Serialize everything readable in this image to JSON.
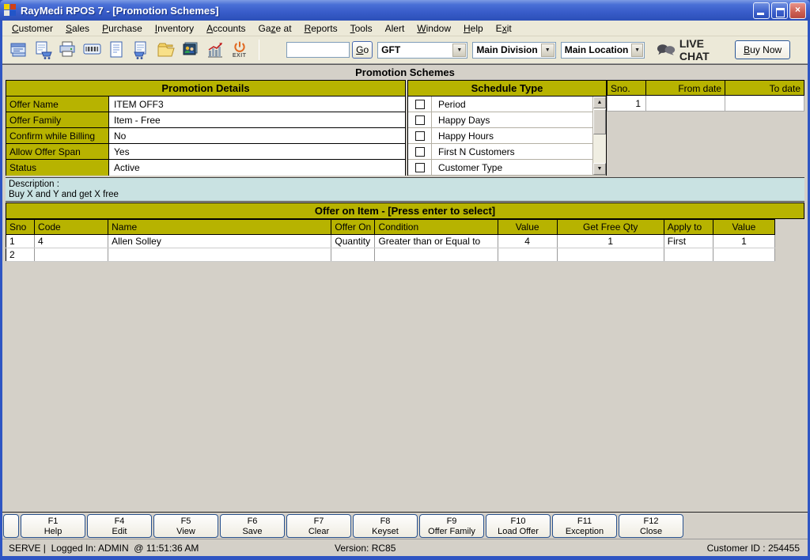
{
  "window": {
    "title": "RayMedi RPOS 7 - [Promotion Schemes]"
  },
  "menu": {
    "items": [
      {
        "label": "Customer",
        "accel": 0
      },
      {
        "label": "Sales",
        "accel": 0
      },
      {
        "label": "Purchase",
        "accel": 0
      },
      {
        "label": "Inventory",
        "accel": 0
      },
      {
        "label": "Accounts",
        "accel": 0
      },
      {
        "label": "Gaze at",
        "accel": 2
      },
      {
        "label": "Reports",
        "accel": 0
      },
      {
        "label": "Tools",
        "accel": 0
      },
      {
        "label": "Alert",
        "accel": -1
      },
      {
        "label": "Window",
        "accel": 0
      },
      {
        "label": "Help",
        "accel": 0
      },
      {
        "label": "Exit",
        "accel": 1
      }
    ]
  },
  "toolbar": {
    "icons": [
      "billing-icon",
      "sales-cart-icon",
      "printer-icon",
      "barcode-icon",
      "ledger-icon",
      "purchase-cart-icon",
      "folder-icon",
      "customers-icon",
      "chart-icon",
      "exit-power-icon"
    ],
    "exit_label": "EXIT",
    "search_value": "",
    "go_button": {
      "label": "Go",
      "accel": 0
    },
    "combos": [
      "GFT",
      "Main Division",
      "Main Location"
    ],
    "live_chat_label": "LIVE CHAT",
    "buy_now_button": {
      "label": "Buy Now",
      "accel": 0
    }
  },
  "page": {
    "title": "Promotion Schemes"
  },
  "promotion_details": {
    "header": "Promotion Details",
    "rows": [
      {
        "label": "Offer Name",
        "value": "ITEM OFF3"
      },
      {
        "label": "Offer Family",
        "value": "Item - Free"
      },
      {
        "label": "Confirm while Billing",
        "value": "No"
      },
      {
        "label": "Allow Offer Span",
        "value": "Yes"
      },
      {
        "label": "Status",
        "value": "Active"
      }
    ]
  },
  "schedule_type": {
    "header": "Schedule Type",
    "options": [
      {
        "label": "Period",
        "checked": false
      },
      {
        "label": "Happy Days",
        "checked": false
      },
      {
        "label": "Happy Hours",
        "checked": false
      },
      {
        "label": "First N Customers",
        "checked": false
      },
      {
        "label": "Customer Type",
        "checked": false
      }
    ]
  },
  "schedule_table": {
    "columns": [
      "Sno.",
      "From date",
      "To date"
    ],
    "rows": [
      {
        "sno": "1",
        "from_date": "",
        "to_date": ""
      }
    ]
  },
  "description": {
    "label": "Description :",
    "text": "Buy X and Y and get X free"
  },
  "offer_on_item": {
    "header": "Offer on Item - [Press enter to select]",
    "columns": [
      "Sno",
      "Code",
      "Name",
      "Offer On",
      "Condition",
      "Value",
      "Get Free Qty",
      "Apply to",
      "Value"
    ],
    "rows": [
      [
        "1",
        "4",
        "Allen Solley",
        "Quantity",
        "Greater than or Equal to",
        "4",
        "1",
        "First",
        "1"
      ],
      [
        "2",
        "",
        "",
        "",
        "",
        "",
        "",
        "",
        ""
      ]
    ]
  },
  "function_keys": [
    {
      "key": "F1",
      "label": "Help"
    },
    {
      "key": "F4",
      "label": "Edit"
    },
    {
      "key": "F5",
      "label": "View"
    },
    {
      "key": "F6",
      "label": "Save"
    },
    {
      "key": "F7",
      "label": "Clear"
    },
    {
      "key": "F8",
      "label": "Keyset"
    },
    {
      "key": "F9",
      "label": "Offer Family"
    },
    {
      "key": "F10",
      "label": "Load Offer"
    },
    {
      "key": "F11",
      "label": "Exception"
    },
    {
      "key": "F12",
      "label": "Close"
    }
  ],
  "status_bar": {
    "left": "SERVE |  Logged In: ADMIN  @ 11:51:36 AM",
    "center": "Version: RC85",
    "right": "Customer ID : 254455"
  },
  "colors": {
    "header_olive": "#b7b300",
    "description_bg": "#c9e2e2",
    "titlebar_blue": "#3a5ecb",
    "content_gray": "#d4d0c8"
  }
}
